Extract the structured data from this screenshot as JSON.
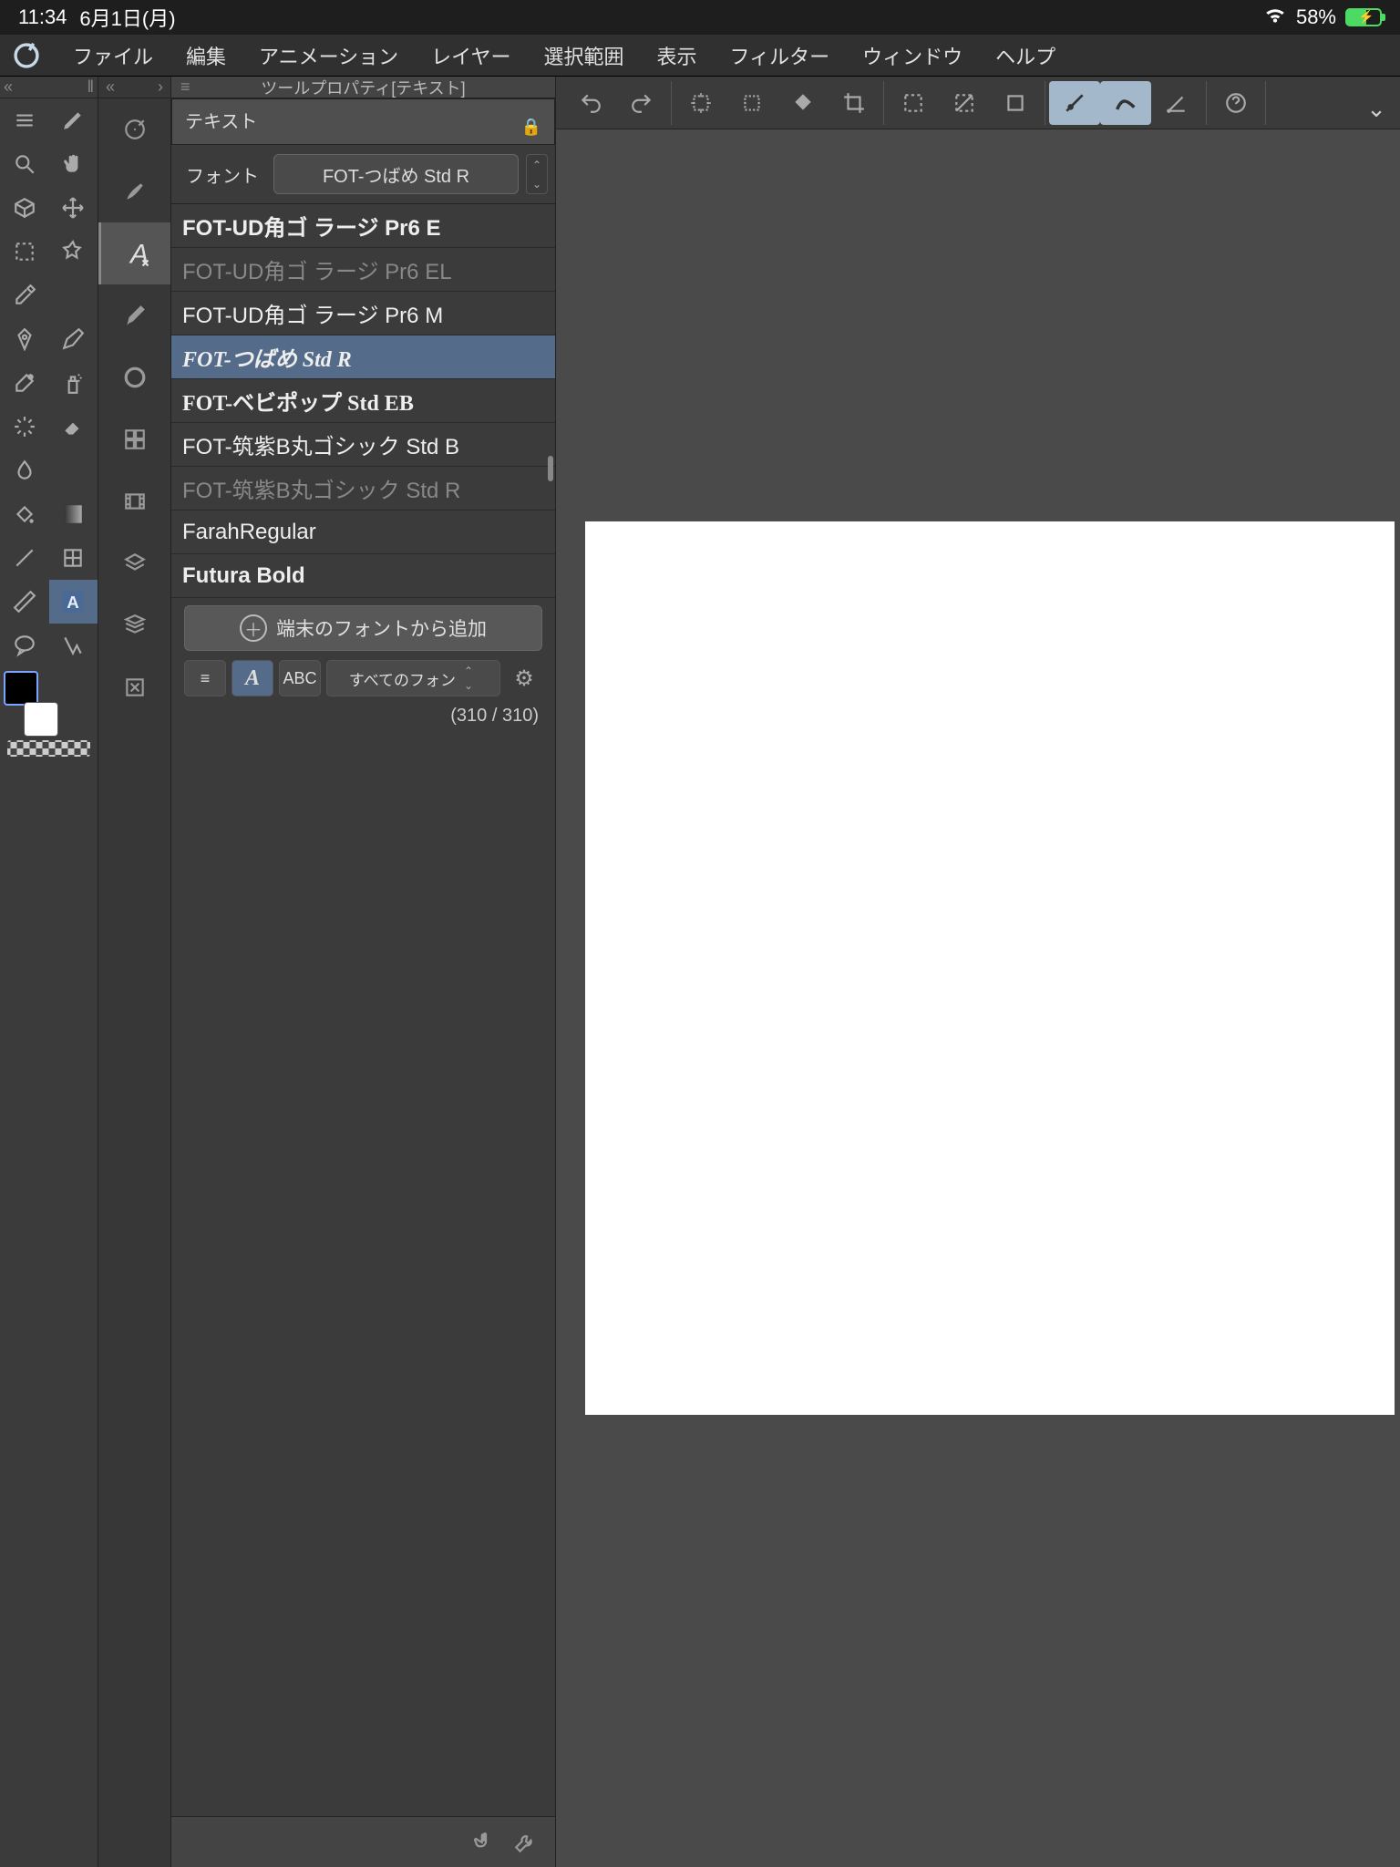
{
  "status": {
    "time": "11:34",
    "date": "6月1日(月)",
    "battery_pct": "58%"
  },
  "menu": {
    "items": [
      "ファイル",
      "編集",
      "アニメーション",
      "レイヤー",
      "選択範囲",
      "表示",
      "フィルター",
      "ウィンドウ",
      "ヘルプ"
    ]
  },
  "prop_panel": {
    "title": "ツールプロパティ[テキスト]",
    "subtitle": "テキスト",
    "font_label": "フォント",
    "font_value": "FOT-つばめ Std R",
    "add_from_device": "端末のフォントから追加",
    "filter_label": "すべてのフォン",
    "abc": "ABC",
    "count": "(310 / 310)"
  },
  "fonts": [
    {
      "name": "FOT-UD角ゴ ラージ Pr6 E",
      "style": "bold"
    },
    {
      "name": "FOT-UD角ゴ ラージ Pr6 EL",
      "style": "dim"
    },
    {
      "name": "FOT-UD角ゴ ラージ Pr6 M",
      "style": ""
    },
    {
      "name": "FOT-つばめ Std R",
      "style": "sel"
    },
    {
      "name": "FOT-ベビポップ Std EB",
      "style": "serif"
    },
    {
      "name": "FOT-筑紫B丸ゴシック Std B",
      "style": ""
    },
    {
      "name": "FOT-筑紫B丸ゴシック Std R",
      "style": "dim"
    },
    {
      "name": "FarahRegular",
      "style": ""
    },
    {
      "name": "Futura Bold",
      "style": "bold"
    }
  ]
}
